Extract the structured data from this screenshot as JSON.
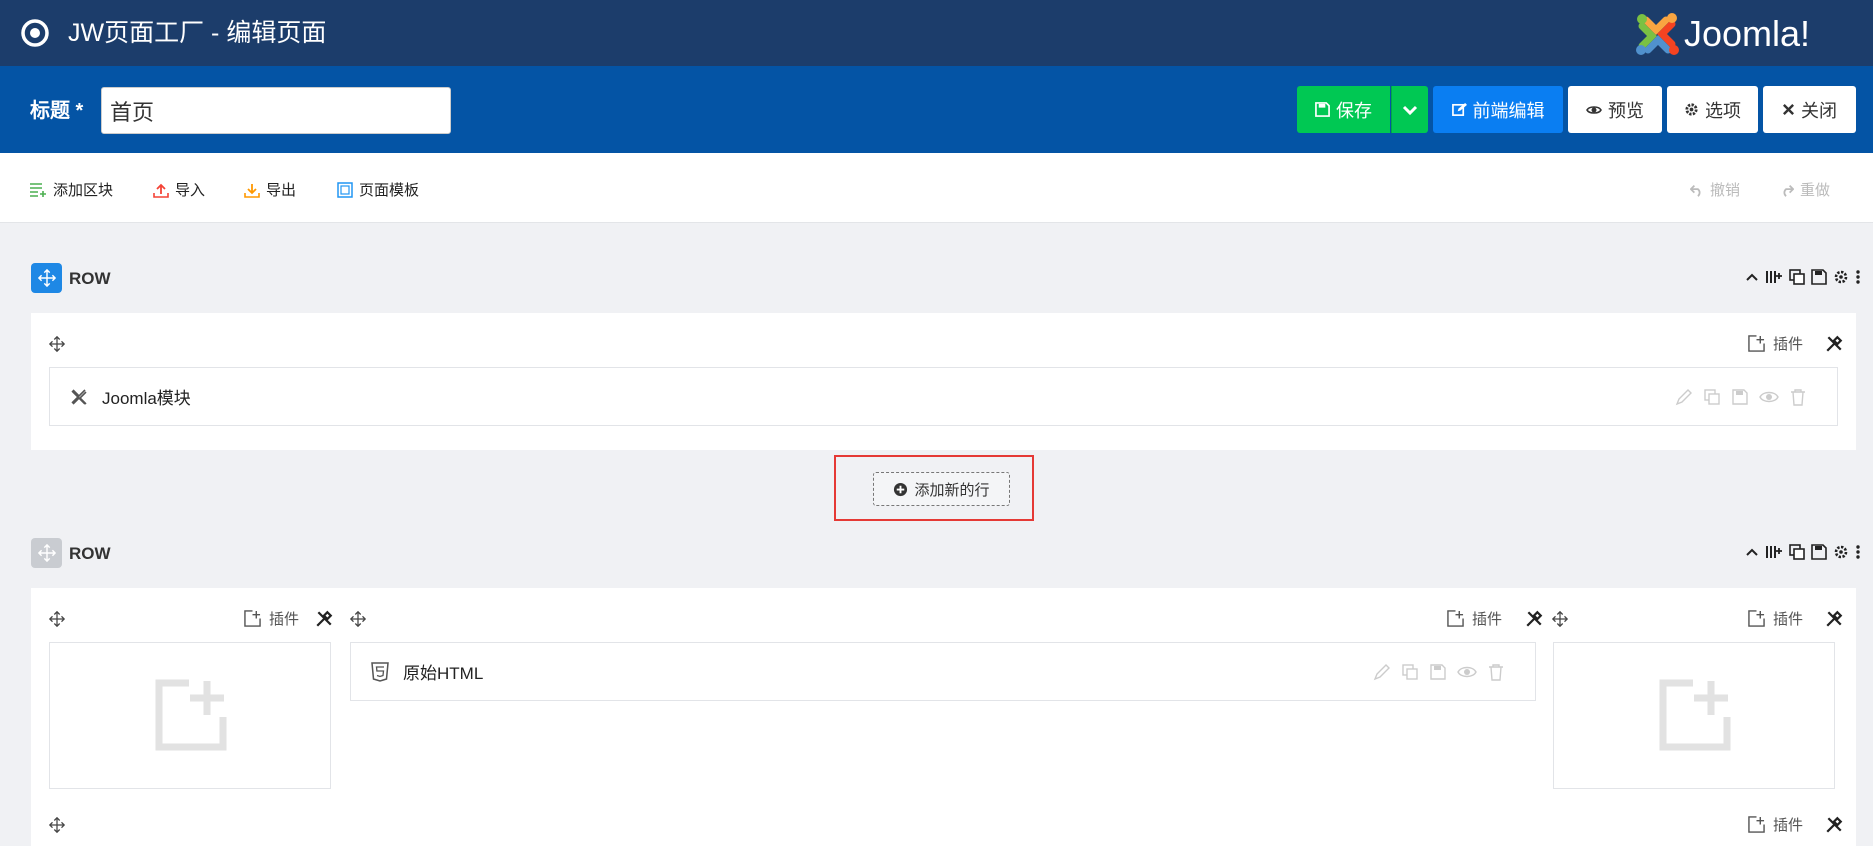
{
  "header": {
    "app_title": "JW页面工厂 - 编辑页面",
    "logo_text": "Joomla!"
  },
  "titlebar": {
    "label": "标题 *",
    "title_value": "首页",
    "buttons": {
      "save": "保存",
      "frontend_edit": "前端编辑",
      "preview": "预览",
      "options": "选项",
      "close": "关闭"
    }
  },
  "toolbar": {
    "add_block": "添加区块",
    "import": "导入",
    "export": "导出",
    "page_template": "页面模板",
    "undo": "撤销",
    "redo": "重做"
  },
  "rows": [
    {
      "label": "ROW",
      "columns": [
        {
          "plugin_label": "插件",
          "addons": [
            {
              "name": "Joomla模块",
              "icon": "joomla-icon"
            }
          ]
        }
      ]
    },
    {
      "label": "ROW",
      "columns": [
        {
          "plugin_label": "插件",
          "addons": []
        },
        {
          "plugin_label": "插件",
          "addons": [
            {
              "name": "原始HTML",
              "icon": "html5-icon"
            }
          ]
        },
        {
          "plugin_label": "插件",
          "addons": []
        }
      ]
    }
  ],
  "bottom_column": {
    "plugin_label": "插件"
  },
  "add_row": {
    "label": "添加新的行"
  },
  "colors": {
    "topbar": "#1c3d6b",
    "titlebar": "#0454a5",
    "save": "#00c853",
    "frontend": "#0a7ef2",
    "highlight": "#e53935"
  }
}
